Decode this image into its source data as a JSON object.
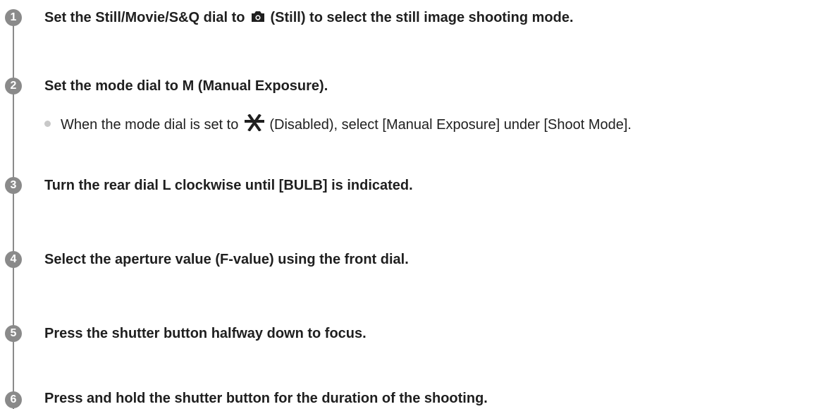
{
  "steps": [
    {
      "number": "1",
      "text_before": "Set the Still/Movie/S&Q dial to",
      "icon": "camera-icon",
      "text_after": "(Still) to select the still image shooting mode."
    },
    {
      "number": "2",
      "text": "Set the mode dial to M (Manual Exposure).",
      "note": {
        "text_before": "When the mode dial is set to",
        "icon": "disabled-mode-icon",
        "text_after": "(Disabled), select [Manual Exposure] under [Shoot Mode]."
      }
    },
    {
      "number": "3",
      "text": "Turn the rear dial L clockwise until [BULB] is indicated."
    },
    {
      "number": "4",
      "text": "Select the aperture value (F-value) using the front dial."
    },
    {
      "number": "5",
      "text": "Press the shutter button halfway down to focus."
    },
    {
      "number": "6",
      "text": "Press and hold the shutter button for the duration of the shooting."
    }
  ],
  "colors": {
    "badge": "#8a8a8a",
    "text": "#1f1f1f",
    "bullet": "#c8c8c8"
  }
}
